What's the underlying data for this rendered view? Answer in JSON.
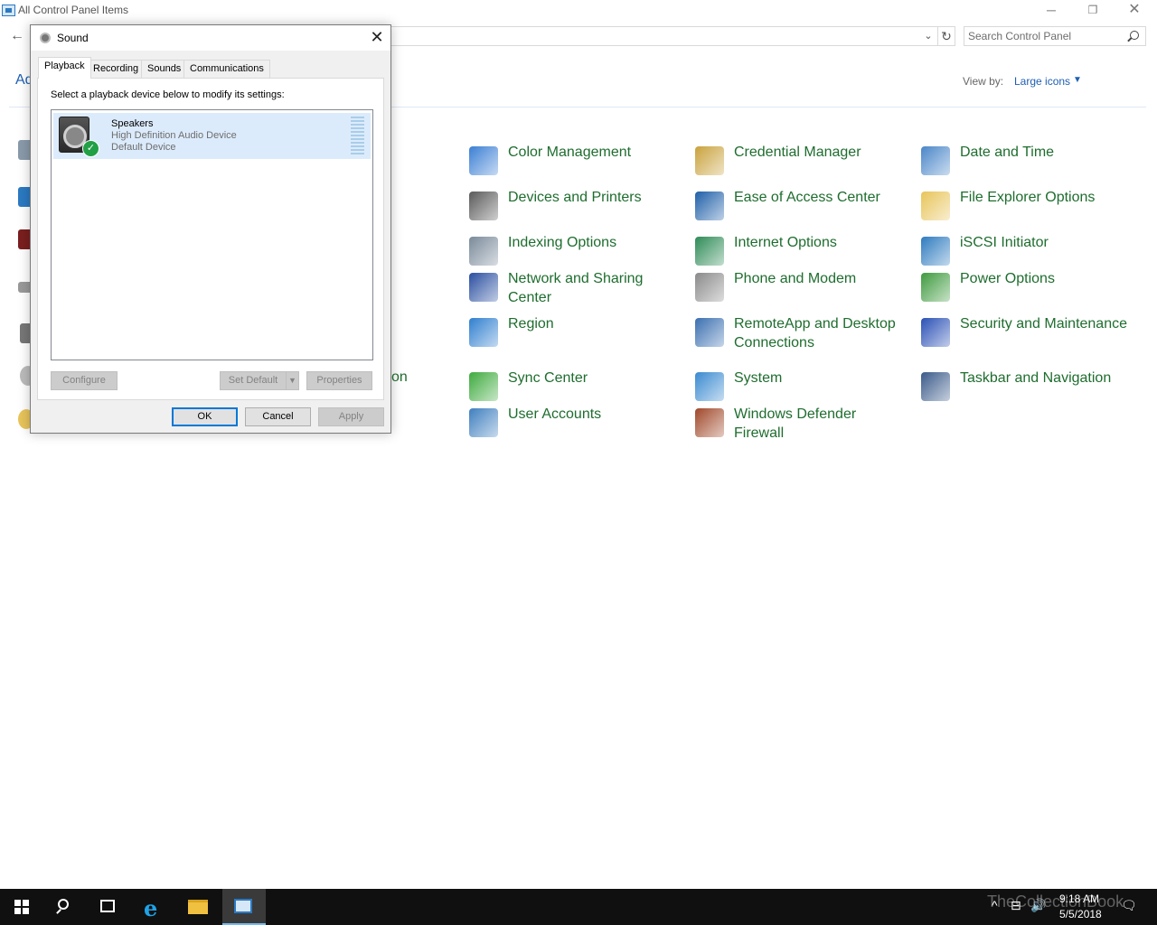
{
  "window": {
    "title": "All Control Panel Items",
    "controls": {
      "minimize": "─",
      "maximize": "❐",
      "close": "✕"
    }
  },
  "toolbar": {
    "back": "←",
    "refresh": "↻",
    "dropdown": "⌄",
    "search_placeholder": "Search Control Panel"
  },
  "header": {
    "partial_title": "Ad",
    "view_by_label": "View by:",
    "view_by_value": "Large icons"
  },
  "partial_item_text": "on",
  "items": [
    {
      "label": "Color Management",
      "icon": "color-management-icon",
      "color": "#3b7fd4"
    },
    {
      "label": "Credential Manager",
      "icon": "credential-manager-icon",
      "color": "#c9a23c"
    },
    {
      "label": "Date and Time",
      "icon": "date-and-time-icon",
      "color": "#4a86c8"
    },
    {
      "label": "Devices and Printers",
      "icon": "devices-and-printers-icon",
      "color": "#5a5a5a"
    },
    {
      "label": "Ease of Access Center",
      "icon": "ease-of-access-icon",
      "color": "#1e5fa8"
    },
    {
      "label": "File Explorer Options",
      "icon": "file-explorer-options-icon",
      "color": "#e8c45a"
    },
    {
      "label": "Indexing Options",
      "icon": "indexing-options-icon",
      "color": "#7a8a9a"
    },
    {
      "label": "Internet Options",
      "icon": "internet-options-icon",
      "color": "#2e8b57"
    },
    {
      "label": "iSCSI Initiator",
      "icon": "iscsi-initiator-icon",
      "color": "#2e7bbf"
    },
    {
      "label": "Network and Sharing Center",
      "icon": "network-sharing-icon",
      "color": "#2a4fa0"
    },
    {
      "label": "Phone and Modem",
      "icon": "phone-modem-icon",
      "color": "#8a8a8a"
    },
    {
      "label": "Power Options",
      "icon": "power-options-icon",
      "color": "#3e9a3e"
    },
    {
      "label": "Region",
      "icon": "region-icon",
      "color": "#2f7fcf"
    },
    {
      "label": "RemoteApp and Desktop Connections",
      "icon": "remoteapp-icon",
      "color": "#3a6fb0"
    },
    {
      "label": "Security and Maintenance",
      "icon": "security-maintenance-icon",
      "color": "#2a50b5"
    },
    {
      "label": "Sync Center",
      "icon": "sync-center-icon",
      "color": "#3eaa3e"
    },
    {
      "label": "System",
      "icon": "system-icon",
      "color": "#3a8ad0"
    },
    {
      "label": "Taskbar and Navigation",
      "icon": "taskbar-navigation-icon",
      "color": "#3a5a8a"
    },
    {
      "label": "User Accounts",
      "icon": "user-accounts-icon",
      "color": "#3f7fbf"
    },
    {
      "label": "Windows Defender Firewall",
      "icon": "firewall-icon",
      "color": "#a0482a"
    }
  ],
  "dialog": {
    "title": "Sound",
    "close": "✕",
    "tabs": [
      "Playback",
      "Recording",
      "Sounds",
      "Communications"
    ],
    "active_tab": "Playback",
    "instruction": "Select a playback device below to modify its settings:",
    "device": {
      "name": "Speakers",
      "description": "High Definition Audio Device",
      "status": "Default Device"
    },
    "buttons": {
      "configure": "Configure",
      "set_default": "Set Default",
      "properties": "Properties",
      "ok": "OK",
      "cancel": "Cancel",
      "apply": "Apply"
    }
  },
  "taskbar": {
    "time": "9:18 AM",
    "date": "5/5/2018",
    "watermark": "TheCollectionBook"
  }
}
